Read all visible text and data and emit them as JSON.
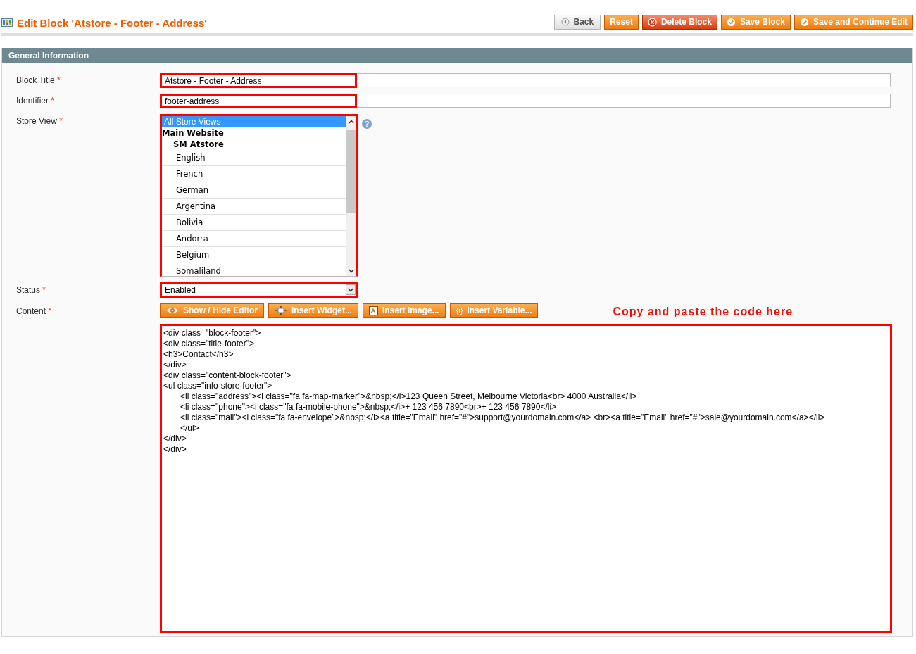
{
  "header": {
    "title": "Edit Block 'Atstore - Footer - Address'",
    "buttons": [
      {
        "label": "Back",
        "kind": "back"
      },
      {
        "label": "Reset",
        "kind": "plain"
      },
      {
        "label": "Delete Block",
        "kind": "delete"
      },
      {
        "label": "Save Block",
        "kind": "save"
      },
      {
        "label": "Save and Continue Edit",
        "kind": "save"
      }
    ]
  },
  "section": {
    "title": "General Information"
  },
  "block_title": {
    "label": "Block Title",
    "mark": "*",
    "value": "Atstore - Footer - Address",
    "highlighted": true
  },
  "identifier": {
    "label": "Identifier",
    "mark": "*",
    "value": "footer-address",
    "highlighted": true
  },
  "store_view": {
    "label": "Store View",
    "mark": "*",
    "help": "?",
    "highlighted": true,
    "options": [
      {
        "text": "All Store Views",
        "kind": "option",
        "selected": true
      },
      {
        "text": "Main Website",
        "kind": "website",
        "selected": false
      },
      {
        "text": "SM Atstore",
        "kind": "store",
        "selected": false
      },
      {
        "text": "English",
        "kind": "view",
        "selected": false
      },
      {
        "text": "French",
        "kind": "view",
        "selected": false
      },
      {
        "text": "German",
        "kind": "view",
        "selected": false
      },
      {
        "text": "Argentina",
        "kind": "view",
        "selected": false
      },
      {
        "text": "Bolivia",
        "kind": "view",
        "selected": false
      },
      {
        "text": "Andorra",
        "kind": "view",
        "selected": false
      },
      {
        "text": "Belgium",
        "kind": "view",
        "selected": false
      },
      {
        "text": "Somaliland",
        "kind": "view",
        "selected": false
      }
    ]
  },
  "status": {
    "label": "Status",
    "mark": "*",
    "value": "Enabled",
    "highlighted": true
  },
  "content": {
    "label": "Content",
    "mark": "*",
    "highlighted": true,
    "buttons": [
      {
        "label": "Show / Hide Editor",
        "kind": "eye"
      },
      {
        "label": "Insert Widget...",
        "kind": "widget"
      },
      {
        "label": "Insert Image...",
        "kind": "image"
      },
      {
        "label": "Insert Variable...",
        "kind": "variable",
        "glyph": "{i}"
      }
    ],
    "annotation": "Copy and paste the code here",
    "lines": [
      {
        "text": "<div class=\"block-footer\">",
        "indented": false
      },
      {
        "text": "<div class=\"title-footer\">",
        "indented": false
      },
      {
        "text": "<h3>Contact</h3>",
        "indented": false
      },
      {
        "text": "</div>",
        "indented": false
      },
      {
        "text": "<div class=\"content-block-footer\">",
        "indented": false
      },
      {
        "text": "<ul class=\"info-store-footer\">",
        "indented": false
      },
      {
        "text": "<li class=\"address\"><i class=\"fa fa-map-marker\">&nbsp;</i>123 Queen Street, Melbourne Victoria<br> 4000 Australia</li>",
        "indented": true
      },
      {
        "text": "<li class=\"phone\"><i class=\"fa fa-mobile-phone\">&nbsp;</i>+ 123 456 7890<br>+ 123 456 7890</li>",
        "indented": true
      },
      {
        "text": "<li class=\"mail\"><i class=\"fa fa-envelope\">&nbsp;</i><a title=\"Email\" href=\"#\">support@yourdomain.com</a> <br><a title=\"Email\" href=\"#\">sale@yourdomain.com</a></li>",
        "indented": true
      },
      {
        "text": "</ul>",
        "indented": true
      },
      {
        "text": "</div>",
        "indented": false
      },
      {
        "text": "</div>",
        "indented": false
      }
    ]
  }
}
